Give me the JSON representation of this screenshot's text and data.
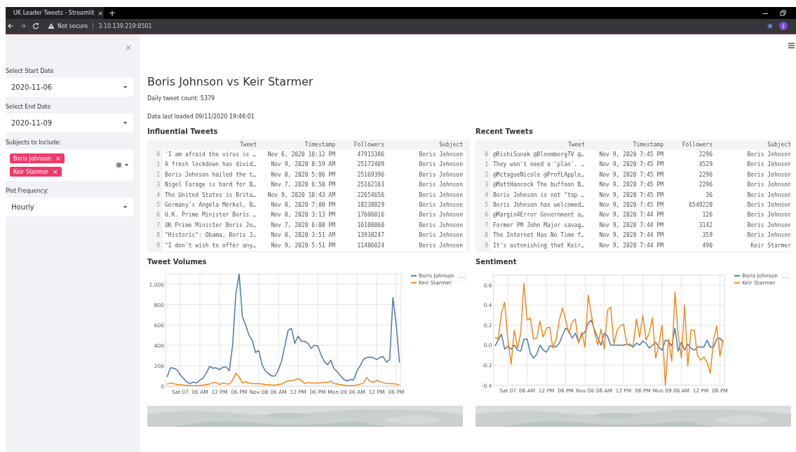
{
  "browser": {
    "tab_title": "UK Leader Tweets - Streamlit",
    "tab_close": "×",
    "new_tab": "+",
    "security": "Not secure",
    "url": "3.10.139.219:8501",
    "profile": "J"
  },
  "sidebar": {
    "close": "×",
    "fields": [
      {
        "kind": "select",
        "label": "Select Start Date",
        "value": "2020-11-06"
      },
      {
        "kind": "select",
        "label": "Select End Date",
        "value": "2020-11-09"
      },
      {
        "kind": "multiselect",
        "label": "Subjects to Include:",
        "tags": [
          {
            "text": "Boris Johnson",
            "remove": "×"
          },
          {
            "text": "Keir Starmer",
            "remove": "×"
          }
        ]
      },
      {
        "kind": "select",
        "label": "Plot Frequency:",
        "value": "Hourly"
      }
    ]
  },
  "main": {
    "title": "Boris Johnson vs Keir Starmer",
    "stats": [
      "Daily tweet count: 5379",
      "Data last loaded 09/11/2020 19:46:01"
    ],
    "tables": [
      {
        "title": "Influential Tweets",
        "columns": [
          "Tweet",
          "Timestamp",
          "Followers",
          "Subject"
        ],
        "rows": [
          {
            "index": "0",
            "cells": [
              "'I am afraid the virus is …",
              "Nov 6, 2020 10:12 PM",
              "47915386",
              "Boris Johnson"
            ]
          },
          {
            "index": "1",
            "cells": [
              "A fresh lockdown has divid…",
              "Nov 9, 2020 8:59 AM",
              "25172409",
              "Boris Johnson"
            ]
          },
          {
            "index": "2",
            "cells": [
              "Boris Johnson hailed the t…",
              "Nov 8, 2020 5:06 PM",
              "25169396",
              "Boris Johnson"
            ]
          },
          {
            "index": "3",
            "cells": [
              "Nigel Farage is hard for B…",
              "Nov 7, 2020 6:50 PM",
              "25162163",
              "Boris Johnson"
            ]
          },
          {
            "index": "4",
            "cells": [
              "The United States is Brita…",
              "Nov 9, 2020 10:43 AM",
              "22654656",
              "Boris Johnson"
            ]
          },
          {
            "index": "5",
            "cells": [
              "Germany's Angela Merkel, B…",
              "Nov 8, 2020 7:00 PM",
              "18238829",
              "Boris Johnson"
            ]
          },
          {
            "index": "6",
            "cells": [
              "U.K. Prime Minister Boris …",
              "Nov 8, 2020 3:13 PM",
              "17606016",
              "Boris Johnson"
            ]
          },
          {
            "index": "7",
            "cells": [
              "UK Prime Minister Boris Jo…",
              "Nov 7, 2020 6:08 PM",
              "16108060",
              "Boris Johnson"
            ]
          },
          {
            "index": "8",
            "cells": [
              "\"Historic\": Obama, Boris J…",
              "Nov 8, 2020 3:51 AM",
              "13938247",
              "Boris Johnson"
            ]
          },
          {
            "index": "9",
            "cells": [
              "\"I don't wish to offer any…",
              "Nov 9, 2020 5:51 PM",
              "11486024",
              "Boris Johnson"
            ]
          }
        ]
      },
      {
        "title": "Recent Tweets",
        "columns": [
          "Tweet",
          "Timestamp",
          "Followers",
          "Subject"
        ],
        "rows": [
          {
            "index": "0",
            "cells": [
              "@RishiSunak @BloombergTV @…",
              "Nov 9, 2020 7:45 PM",
              "2296",
              "Boris Johnson"
            ]
          },
          {
            "index": "1",
            "cells": [
              "They won't need a 'plan'. …",
              "Nov 9, 2020 7:45 PM",
              "4529",
              "Boris Johnson"
            ]
          },
          {
            "index": "2",
            "cells": [
              "@MctagueNicole @ProfLApple…",
              "Nov 9, 2020 7:45 PM",
              "2296",
              "Boris Johnson"
            ]
          },
          {
            "index": "3",
            "cells": [
              "@MattHancock The buffoon B…",
              "Nov 9, 2020 7:45 PM",
              "2296",
              "Boris Johnson"
            ]
          },
          {
            "index": "4",
            "cells": [
              "Boris Johnson is not \"top …",
              "Nov 9, 2020 7:45 PM",
              "36",
              "Boris Johnson"
            ]
          },
          {
            "index": "5",
            "cells": [
              "Boris Johnson has welcomed…",
              "Nov 9, 2020 7:45 PM",
              "6549220",
              "Boris Johnson"
            ]
          },
          {
            "index": "6",
            "cells": [
              "@Margin4Error Government a…",
              "Nov 9, 2020 7:44 PM",
              "126",
              "Boris Johnson"
            ]
          },
          {
            "index": "7",
            "cells": [
              "Former PM John Major savag…",
              "Nov 9, 2020 7:44 PM",
              "3142",
              "Boris Johnson"
            ]
          },
          {
            "index": "8",
            "cells": [
              "The Internet Has No Time f…",
              "Nov 9, 2020 7:44 PM",
              "359",
              "Boris Johnson"
            ]
          },
          {
            "index": "9",
            "cells": [
              "It's astonishing that Keir…",
              "Nov 9, 2020 7:44 PM",
              "490",
              "Keir Starmer"
            ]
          }
        ]
      }
    ],
    "charts": [
      {
        "title": "Tweet Volumes",
        "chart_data": {
          "type": "line",
          "grid": true,
          "legend": true,
          "x": [
            "2020-11-06T20:00",
            "2020-11-06T21:00",
            "2020-11-06T22:00",
            "2020-11-06T23:00",
            "2020-11-07T00:00",
            "2020-11-07T01:00",
            "2020-11-07T02:00",
            "2020-11-07T03:00",
            "2020-11-07T04:00",
            "2020-11-07T05:00",
            "2020-11-07T06:00",
            "2020-11-07T07:00",
            "2020-11-07T08:00",
            "2020-11-07T09:00",
            "2020-11-07T10:00",
            "2020-11-07T11:00",
            "2020-11-07T12:00",
            "2020-11-07T13:00",
            "2020-11-07T14:00",
            "2020-11-07T15:00",
            "2020-11-07T16:00",
            "2020-11-07T17:00",
            "2020-11-07T18:00",
            "2020-11-07T19:00",
            "2020-11-07T20:00",
            "2020-11-07T21:00",
            "2020-11-07T22:00",
            "2020-11-07T23:00",
            "2020-11-08T00:00",
            "2020-11-08T01:00",
            "2020-11-08T02:00",
            "2020-11-08T03:00",
            "2020-11-08T04:00",
            "2020-11-08T05:00",
            "2020-11-08T06:00",
            "2020-11-08T07:00",
            "2020-11-08T08:00",
            "2020-11-08T09:00",
            "2020-11-08T10:00",
            "2020-11-08T11:00",
            "2020-11-08T12:00",
            "2020-11-08T13:00",
            "2020-11-08T14:00",
            "2020-11-08T15:00",
            "2020-11-08T16:00",
            "2020-11-08T17:00",
            "2020-11-08T18:00",
            "2020-11-08T19:00",
            "2020-11-08T20:00",
            "2020-11-08T21:00",
            "2020-11-08T22:00",
            "2020-11-08T23:00",
            "2020-11-09T00:00",
            "2020-11-09T01:00",
            "2020-11-09T02:00",
            "2020-11-09T03:00",
            "2020-11-09T04:00",
            "2020-11-09T05:00",
            "2020-11-09T06:00",
            "2020-11-09T07:00",
            "2020-11-09T08:00",
            "2020-11-09T09:00",
            "2020-11-09T10:00",
            "2020-11-09T11:00",
            "2020-11-09T12:00",
            "2020-11-09T13:00",
            "2020-11-09T14:00",
            "2020-11-09T15:00",
            "2020-11-09T16:00",
            "2020-11-09T17:00",
            "2020-11-09T18:00",
            "2020-11-09T19:00"
          ],
          "series": [
            {
              "name": "Boris Johnson",
              "color": "#4c78a8",
              "values": [
                90,
                180,
                175,
                160,
                110,
                75,
                40,
                25,
                40,
                30,
                60,
                80,
                130,
                195,
                175,
                180,
                160,
                185,
                190,
                150,
                400,
                900,
                1100,
                680,
                600,
                500,
                450,
                330,
                350,
                210,
                150,
                120,
                100,
                100,
                160,
                250,
                400,
                550,
                565,
                420,
                490,
                440,
                440,
                420,
                370,
                400,
                395,
                310,
                240,
                210,
                255,
                170,
                140,
                100,
                65,
                50,
                65,
                60,
                150,
                200,
                265,
                280,
                285,
                280,
                260,
                280,
                290,
                235,
                260,
                870,
                600,
                230
              ]
            },
            {
              "name": "Keir Starmer",
              "color": "#f58518",
              "values": [
                20,
                30,
                25,
                15,
                15,
                10,
                8,
                5,
                5,
                5,
                5,
                10,
                15,
                20,
                35,
                35,
                15,
                30,
                25,
                20,
                60,
                125,
                90,
                30,
                45,
                30,
                25,
                25,
                25,
                20,
                15,
                15,
                10,
                10,
                15,
                20,
                40,
                50,
                55,
                60,
                75,
                55,
                25,
                35,
                30,
                30,
                30,
                30,
                40,
                35,
                50,
                25,
                20,
                15,
                10,
                5,
                5,
                5,
                10,
                20,
                30,
                85,
                45,
                40,
                55,
                45,
                35,
                25,
                25,
                25,
                20,
                10
              ]
            }
          ],
          "xlim": [
            "2020-11-06T19:30",
            "2020-11-09T19:30"
          ],
          "ylim": [
            0,
            1100
          ],
          "xticks": [
            {
              "value": "2020-11-07T00:00",
              "label": "Sat 07"
            },
            {
              "value": "2020-11-07T06:00",
              "label": "06 AM"
            },
            {
              "value": "2020-11-07T12:00",
              "label": "12 PM"
            },
            {
              "value": "2020-11-07T18:00",
              "label": "06 PM"
            },
            {
              "value": "2020-11-08T00:00",
              "label": "Nov 08"
            },
            {
              "value": "2020-11-08T06:00",
              "label": "06 AM"
            },
            {
              "value": "2020-11-08T12:00",
              "label": "12 PM"
            },
            {
              "value": "2020-11-08T18:00",
              "label": "06 PM"
            },
            {
              "value": "2020-11-09T00:00",
              "label": "Mon 09"
            },
            {
              "value": "2020-11-09T06:00",
              "label": "06 AM"
            },
            {
              "value": "2020-11-09T12:00",
              "label": "12 PM"
            },
            {
              "value": "2020-11-09T18:00",
              "label": "06 PM"
            }
          ],
          "yticks": [
            0,
            200,
            400,
            600,
            800,
            {
              "value": 1000,
              "label": "1,000"
            }
          ]
        }
      },
      {
        "title": "Sentiment",
        "chart_data": {
          "type": "line",
          "grid": true,
          "legend": true,
          "x": [
            "2020-11-06T20:00",
            "2020-11-06T21:00",
            "2020-11-06T22:00",
            "2020-11-06T23:00",
            "2020-11-07T00:00",
            "2020-11-07T01:00",
            "2020-11-07T02:00",
            "2020-11-07T03:00",
            "2020-11-07T04:00",
            "2020-11-07T05:00",
            "2020-11-07T06:00",
            "2020-11-07T07:00",
            "2020-11-07T08:00",
            "2020-11-07T09:00",
            "2020-11-07T10:00",
            "2020-11-07T11:00",
            "2020-11-07T12:00",
            "2020-11-07T13:00",
            "2020-11-07T14:00",
            "2020-11-07T15:00",
            "2020-11-07T16:00",
            "2020-11-07T17:00",
            "2020-11-07T18:00",
            "2020-11-07T19:00",
            "2020-11-07T20:00",
            "2020-11-07T21:00",
            "2020-11-07T22:00",
            "2020-11-07T23:00",
            "2020-11-08T00:00",
            "2020-11-08T01:00",
            "2020-11-08T02:00",
            "2020-11-08T03:00",
            "2020-11-08T04:00",
            "2020-11-08T05:00",
            "2020-11-08T06:00",
            "2020-11-08T07:00",
            "2020-11-08T08:00",
            "2020-11-08T09:00",
            "2020-11-08T10:00",
            "2020-11-08T11:00",
            "2020-11-08T12:00",
            "2020-11-08T13:00",
            "2020-11-08T14:00",
            "2020-11-08T15:00",
            "2020-11-08T16:00",
            "2020-11-08T17:00",
            "2020-11-08T18:00",
            "2020-11-08T19:00",
            "2020-11-08T20:00",
            "2020-11-08T21:00",
            "2020-11-08T22:00",
            "2020-11-08T23:00",
            "2020-11-09T00:00",
            "2020-11-09T01:00",
            "2020-11-09T02:00",
            "2020-11-09T03:00",
            "2020-11-09T04:00",
            "2020-11-09T05:00",
            "2020-11-09T06:00",
            "2020-11-09T07:00",
            "2020-11-09T08:00",
            "2020-11-09T09:00",
            "2020-11-09T10:00",
            "2020-11-09T11:00",
            "2020-11-09T12:00",
            "2020-11-09T13:00",
            "2020-11-09T14:00",
            "2020-11-09T15:00",
            "2020-11-09T16:00",
            "2020-11-09T17:00",
            "2020-11-09T18:00",
            "2020-11-09T19:00"
          ],
          "series": [
            {
              "name": "Boris Johnson",
              "color": "#4c78a8",
              "values": [
                -0.01,
                0.05,
                0.11,
                -0.04,
                -0.01,
                -0.04,
                0,
                -0.05,
                -0.06,
                0.06,
                0.06,
                -0.08,
                -0.13,
                -0.09,
                0,
                -0.05,
                -0.07,
                -0.01,
                -0.01,
                -0.02,
                0.02,
                0.1,
                0.17,
                0.14,
                0.07,
                0.12,
                0.03,
                0.1,
                0.13,
                0.22,
                0.25,
                0.15,
                0.07,
                0,
                0.12,
                0.09,
                0,
                0,
                0,
                0,
                0,
                0.01,
                0.01,
                -0.02,
                0.02,
                0,
                0.04,
                0.02,
                -0.03,
                0,
                0.03,
                -0.02,
                -0.05,
                0.05,
                0.04,
                -0.01,
                0.17,
                -0.06,
                0.03,
                -0.05,
                0.01,
                -0.03,
                -0.05,
                -0.02,
                -0.02,
                -0.02,
                0.05,
                -0.02,
                -0.02,
                0.06,
                0.07,
                0.03
              ]
            },
            {
              "name": "Keir Starmer",
              "color": "#f58518",
              "values": [
                0.08,
                0.06,
                0.32,
                0.43,
                0.05,
                -0.19,
                0.15,
                -0.03,
                0.12,
                0.62,
                0.25,
                0.27,
                0.06,
                0.07,
                0.24,
                0.08,
                0.17,
                0.18,
                -0.03,
                0.05,
                0.25,
                0.37,
                0.25,
                0.12,
                0.23,
                0.26,
                0.02,
                0.13,
                -0.02,
                0.5,
                0.3,
                0.12,
                0,
                0.16,
                -0.04,
                0.35,
                0.38,
                0.01,
                0.15,
                0.19,
                0.21,
                0.01,
                -0.01,
                0,
                0.26,
                0.08,
                0.3,
                0.05,
                0.12,
                0.27,
                -0.13,
                0.01,
                0.2,
                -0.4,
                0.06,
                -0.16,
                0.53,
                0.1,
                -0.13,
                0.4,
                -0.21,
                0.15,
                0.15,
                -0.1,
                -0.15,
                -0.12,
                -0.17,
                -0.28,
                0.05,
                0.19,
                -0.11,
                0.05
              ]
            }
          ],
          "xlim": [
            "2020-11-06T19:30",
            "2020-11-09T19:30"
          ],
          "ylim": [
            -0.4,
            0.7
          ],
          "xticks": [
            {
              "value": "2020-11-07T00:00",
              "label": "Sat 07"
            },
            {
              "value": "2020-11-07T06:00",
              "label": "06 AM"
            },
            {
              "value": "2020-11-07T12:00",
              "label": "12 PM"
            },
            {
              "value": "2020-11-07T18:00",
              "label": "06 PM"
            },
            {
              "value": "2020-11-08T00:00",
              "label": "Nov 08"
            },
            {
              "value": "2020-11-08T06:00",
              "label": "06 AM"
            },
            {
              "value": "2020-11-08T12:00",
              "label": "12 PM"
            },
            {
              "value": "2020-11-08T18:00",
              "label": "06 PM"
            },
            {
              "value": "2020-11-09T00:00",
              "label": "Mon 09"
            },
            {
              "value": "2020-11-09T06:00",
              "label": "06 AM"
            },
            {
              "value": "2020-11-09T12:00",
              "label": "12 PM"
            },
            {
              "value": "2020-11-09T18:00",
              "label": "06 PM"
            }
          ],
          "yticks": [
            -0.4,
            -0.2,
            {
              "value": 0,
              "label": "0.0"
            },
            0.2,
            0.4,
            0.6
          ]
        }
      }
    ]
  }
}
